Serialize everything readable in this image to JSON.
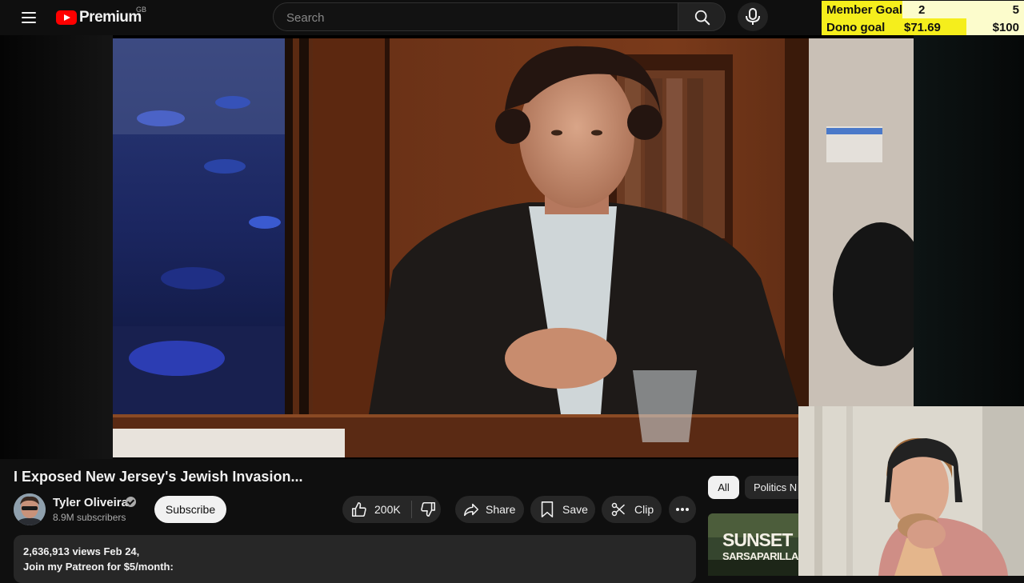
{
  "header": {
    "logo_text": "Premium",
    "region": "GB",
    "search_placeholder": "Search"
  },
  "goals": {
    "member": {
      "label": "Member Goal",
      "current": "2",
      "target": "5",
      "progress": 0.4
    },
    "dono": {
      "label": "Dono goal",
      "current": "$71.69",
      "target": "$100",
      "progress": 0.7169
    }
  },
  "video": {
    "title": "I Exposed New Jersey's Jewish Invasion...",
    "channel": {
      "name": "Tyler Oliveira",
      "subscribers": "8.9M subscribers"
    },
    "subscribe_label": "Subscribe",
    "actions": {
      "likes": "200K",
      "share": "Share",
      "save": "Save",
      "clip": "Clip"
    },
    "description": {
      "stats": "2,636,913 views  Feb 24,",
      "line1": "Join my Patreon for $5/month:"
    }
  },
  "sidebar": {
    "chips": [
      "All",
      "Politics N"
    ],
    "thumbnail": {
      "line1": "SUNSET",
      "line2": "SARSAPARILLA"
    }
  },
  "colors": {
    "accent_red": "#ff0000",
    "goal_fill": "#f5ee1c",
    "goal_bg": "#fcfccc"
  }
}
